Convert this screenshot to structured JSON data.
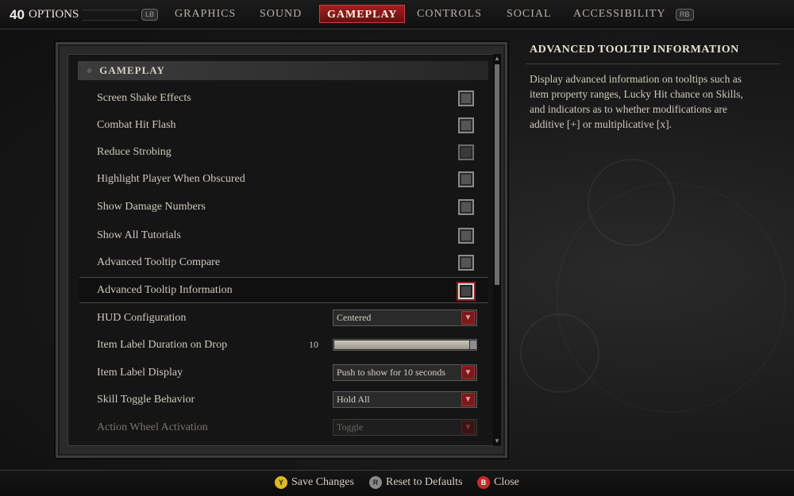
{
  "header": {
    "level": "40",
    "title": "OPTIONS",
    "lb_label": "LB",
    "rb_label": "RB",
    "tabs": [
      {
        "label": "GRAPHICS",
        "active": false
      },
      {
        "label": "SOUND",
        "active": false
      },
      {
        "label": "GAMEPLAY",
        "active": true
      },
      {
        "label": "CONTROLS",
        "active": false
      },
      {
        "label": "SOCIAL",
        "active": false
      },
      {
        "label": "ACCESSIBILITY",
        "active": false
      }
    ]
  },
  "section": {
    "title": "GAMEPLAY",
    "icon": "diamond-dots-icon"
  },
  "settings": {
    "screen_shake": {
      "label": "Screen Shake Effects",
      "checked": true
    },
    "combat_hit_flash": {
      "label": "Combat Hit Flash",
      "checked": true
    },
    "reduce_strobing": {
      "label": "Reduce Strobing",
      "checked": false
    },
    "highlight_player": {
      "label": "Highlight Player When Obscured",
      "checked": true
    },
    "damage_numbers": {
      "label": "Show Damage Numbers",
      "checked": true
    },
    "all_tutorials": {
      "label": "Show All Tutorials",
      "checked": true
    },
    "tooltip_compare": {
      "label": "Advanced Tooltip Compare",
      "checked": true
    },
    "tooltip_info": {
      "label": "Advanced Tooltip Information",
      "checked": true
    },
    "hud_config": {
      "label": "HUD Configuration",
      "value": "Centered"
    },
    "label_duration": {
      "label": "Item Label Duration on Drop",
      "value": "10",
      "fill_fraction": 1.0
    },
    "label_display": {
      "label": "Item Label Display",
      "value": "Push to show for 10 seconds"
    },
    "skill_toggle": {
      "label": "Skill Toggle Behavior",
      "value": "Hold All"
    },
    "action_wheel": {
      "label": "Action Wheel Activation",
      "value": "Toggle",
      "disabled": true
    }
  },
  "info": {
    "title": "ADVANCED TOOLTIP INFORMATION",
    "description": "Display advanced information on tooltips such as item property ranges, Lucky Hit chance on Skills, and indicators as to whether modifications are additive [+] or multiplicative [x]."
  },
  "footer": {
    "save": {
      "button": "Y",
      "label": "Save Changes",
      "color": "#e0b820"
    },
    "reset": {
      "button": "R",
      "label": "Reset to Defaults",
      "color": "#8a8a8a"
    },
    "close": {
      "button": "B",
      "label": "Close",
      "color": "#c82828"
    }
  },
  "colors": {
    "accent": "#a02020",
    "background": "#141414"
  }
}
